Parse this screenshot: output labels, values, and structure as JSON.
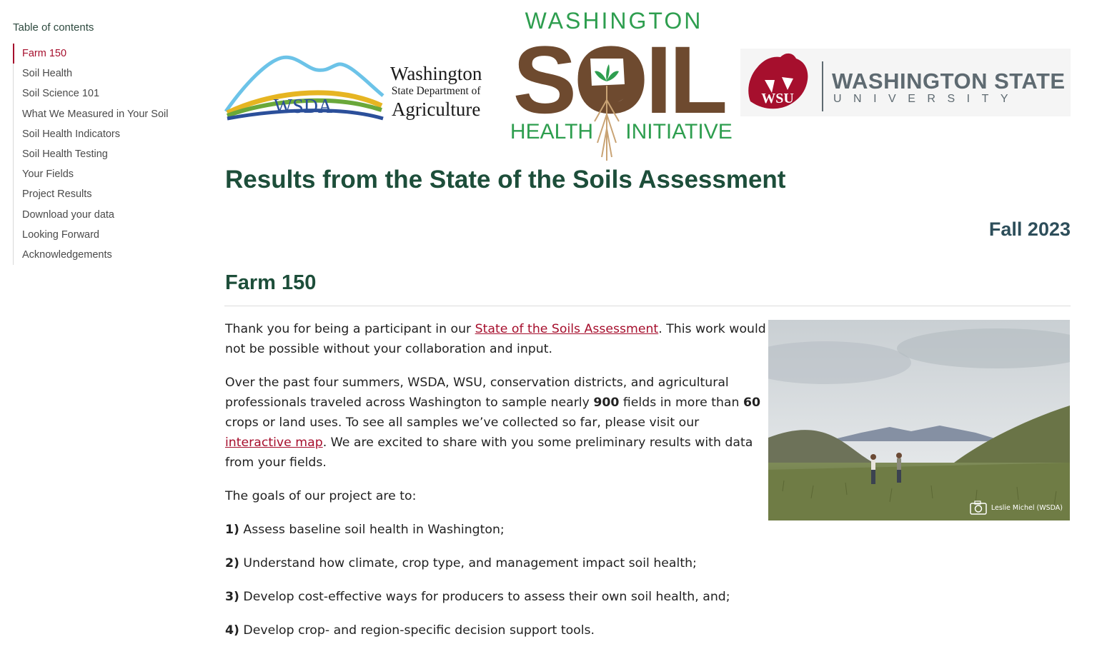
{
  "toc": {
    "title": "Table of contents",
    "items": [
      {
        "label": "Farm 150",
        "active": true
      },
      {
        "label": "Soil Health"
      },
      {
        "label": "Soil Science 101"
      },
      {
        "label": "What We Measured in Your Soil"
      },
      {
        "label": "Soil Health Indicators"
      },
      {
        "label": "Soil Health Testing"
      },
      {
        "label": "Your Fields"
      },
      {
        "label": "Project Results"
      },
      {
        "label": "Download your data"
      },
      {
        "label": "Looking Forward"
      },
      {
        "label": "Acknowledgements"
      }
    ]
  },
  "logos": {
    "wsda_mark": "WSDA",
    "wsda_line1": "Washington",
    "wsda_line2": "State Department of",
    "wsda_line3": "Agriculture",
    "soil_top": "WASHINGTON",
    "soil_word": "SOIL",
    "soil_bottom_left": "HEALTH",
    "soil_bottom_right": "INITIATIVE",
    "wsu_name": "WASHINGTON STATE",
    "wsu_sub": "UNIVERSITY"
  },
  "colors": {
    "accent": "#a60f2d",
    "title_green": "#1d4e3a",
    "soil_brown": "#6e4a2f",
    "soil_green": "#2e9e4f",
    "wsu_crimson": "#a60f2d"
  },
  "header": {
    "title": "Results from the State of the Soils Assessment",
    "season": "Fall 2023"
  },
  "section": {
    "title": "Farm 150",
    "p1_pre": "Thank you for being a participant in our ",
    "p1_link": "State of the Soils Assessment",
    "p1_post": ". This work would not be possible without your collaboration and input.",
    "p2_a": "Over the past four summers, WSDA, WSU, conservation districts, and agricultural professionals traveled across Washington to sample nearly ",
    "p2_b": "900",
    "p2_c": " fields in more than ",
    "p2_d": "60",
    "p2_e": " crops or land uses. To see all samples we’ve collected so far, please visit our ",
    "p2_link": "interactive map",
    "p2_f": ". We are excited to share with you some preliminary results with data from your fields.",
    "p3": "The goals of our project are to:",
    "goals": [
      {
        "num": "1)",
        "text": " Assess baseline soil health in Washington;"
      },
      {
        "num": "2)",
        "text": " Understand how climate, crop type, and management impact soil health;"
      },
      {
        "num": "3)",
        "text": " Develop cost-effective ways for producers to assess their own soil health, and;"
      },
      {
        "num": "4)",
        "text": " Develop crop- and region-specific decision support tools."
      }
    ],
    "photo_caption": "Leslie Michel (WSDA)",
    "camera_icon": "camera-icon"
  }
}
